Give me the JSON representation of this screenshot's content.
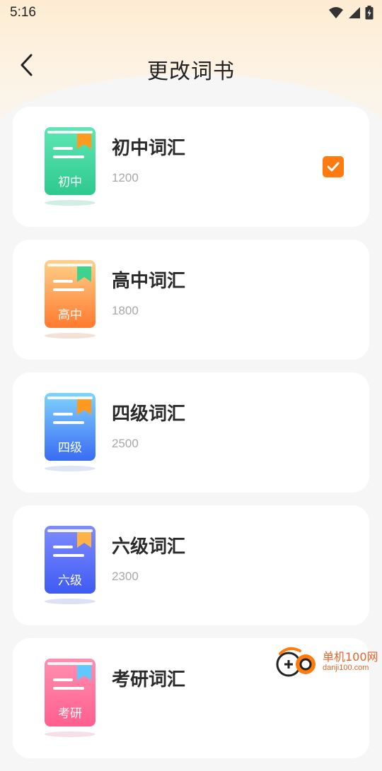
{
  "status_bar": {
    "time": "5:16"
  },
  "header": {
    "title": "更改词书"
  },
  "books": [
    {
      "title": "初中词汇",
      "count": "1200",
      "cover_label": "初中",
      "selected": true,
      "cover_top": "#5fe6b4",
      "cover_bottom": "#2ec98f",
      "bookmark_color": "#ff9a1f",
      "shadow_color": "#7ccfb0"
    },
    {
      "title": "高中词汇",
      "count": "1800",
      "cover_label": "高中",
      "selected": false,
      "cover_top": "#ffd08a",
      "cover_bottom": "#ff7a2f",
      "bookmark_color": "#3ed28f",
      "shadow_color": "#d9a88a"
    },
    {
      "title": "四级词汇",
      "count": "2500",
      "cover_label": "四级",
      "selected": false,
      "cover_top": "#7fd3ff",
      "cover_bottom": "#3a6cf3",
      "bookmark_color": "#ff9a1f",
      "shadow_color": "#9db4e6"
    },
    {
      "title": "六级词汇",
      "count": "2300",
      "cover_label": "六级",
      "selected": false,
      "cover_top": "#7f8cff",
      "cover_bottom": "#3f5bf2",
      "bookmark_color": "#ffb347",
      "shadow_color": "#9ea8e6"
    },
    {
      "title": "考研词汇",
      "count": "",
      "cover_label": "考研",
      "selected": false,
      "cover_top": "#ff8fb0",
      "cover_bottom": "#ff5f8f",
      "bookmark_color": "#5fc8ff",
      "shadow_color": "#e6a5b8"
    }
  ],
  "watermark": {
    "name": "单机100网",
    "domain": "danji100.com"
  },
  "colors": {
    "accent": "#ff7b0f",
    "background": "#f6f6f6"
  }
}
